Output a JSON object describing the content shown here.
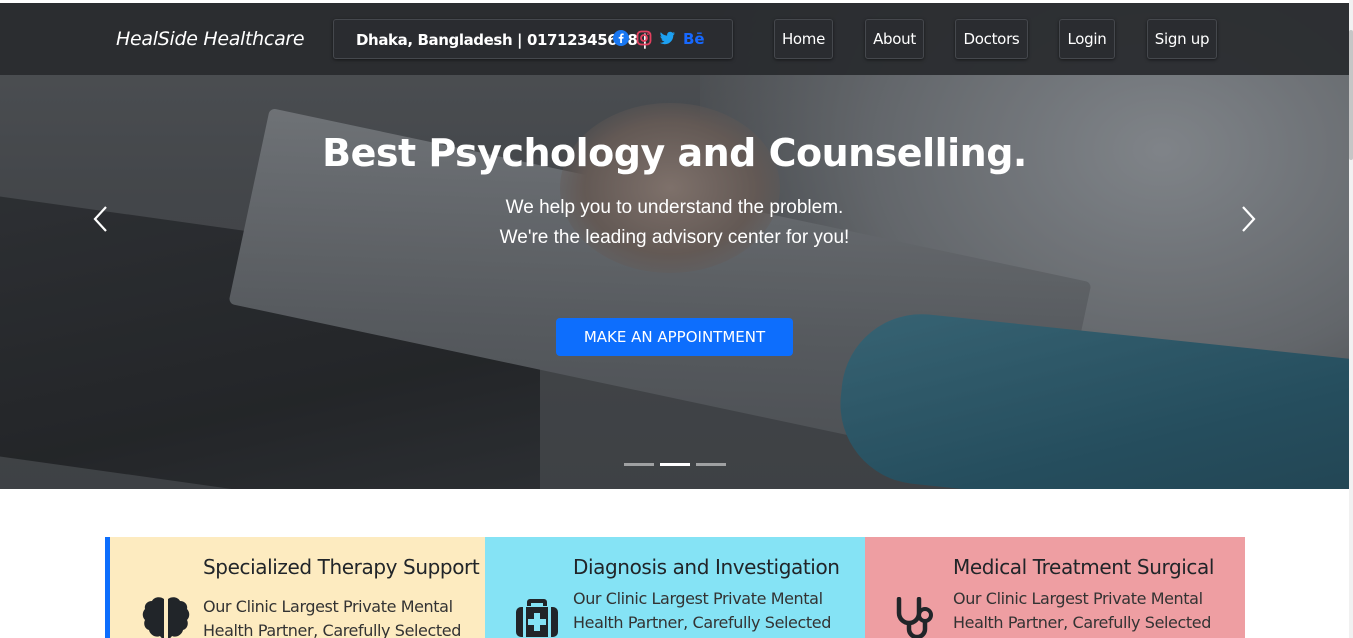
{
  "navbar": {
    "brand": "HealSide Healthcare",
    "contact_text": "Dhaka, Bangladesh | 01712345678 |",
    "social": [
      "facebook-icon",
      "instagram-icon",
      "twitter-icon",
      "behance-icon"
    ],
    "behance_label": "Bē",
    "links": [
      "Home",
      "About",
      "Doctors",
      "Login",
      "Sign up"
    ]
  },
  "hero": {
    "title": "Best Psychology and Counselling.",
    "line1": "We help you to understand the problem.",
    "line2": "We're the leading advisory center for you!",
    "cta": "MAKE AN APPOINTMENT",
    "slides": 3,
    "active_slide": 2
  },
  "features": [
    {
      "title": "Specialized Therapy Support",
      "text1": "Our Clinic Largest Private Mental",
      "text2": "Health Partner, Carefully Selected",
      "icon": "brain-icon",
      "bg": "#fdebc0"
    },
    {
      "title": "Diagnosis and Investigation",
      "text1": "Our Clinic Largest Private Mental",
      "text2": "Health Partner, Carefully Selected",
      "icon": "medical-kit-icon",
      "bg": "#85e3f5"
    },
    {
      "title": "Medical Treatment Surgical",
      "text1": "Our Clinic Largest Private Mental",
      "text2": "Health Partner, Carefully Selected",
      "icon": "stethoscope-icon",
      "bg": "#ee9ea2"
    }
  ],
  "colors": {
    "accent": "#0d6efd",
    "facebook": "#1877f2",
    "instagram": "#e4405f",
    "twitter": "#1da1f2",
    "behance": "#1769ff"
  }
}
